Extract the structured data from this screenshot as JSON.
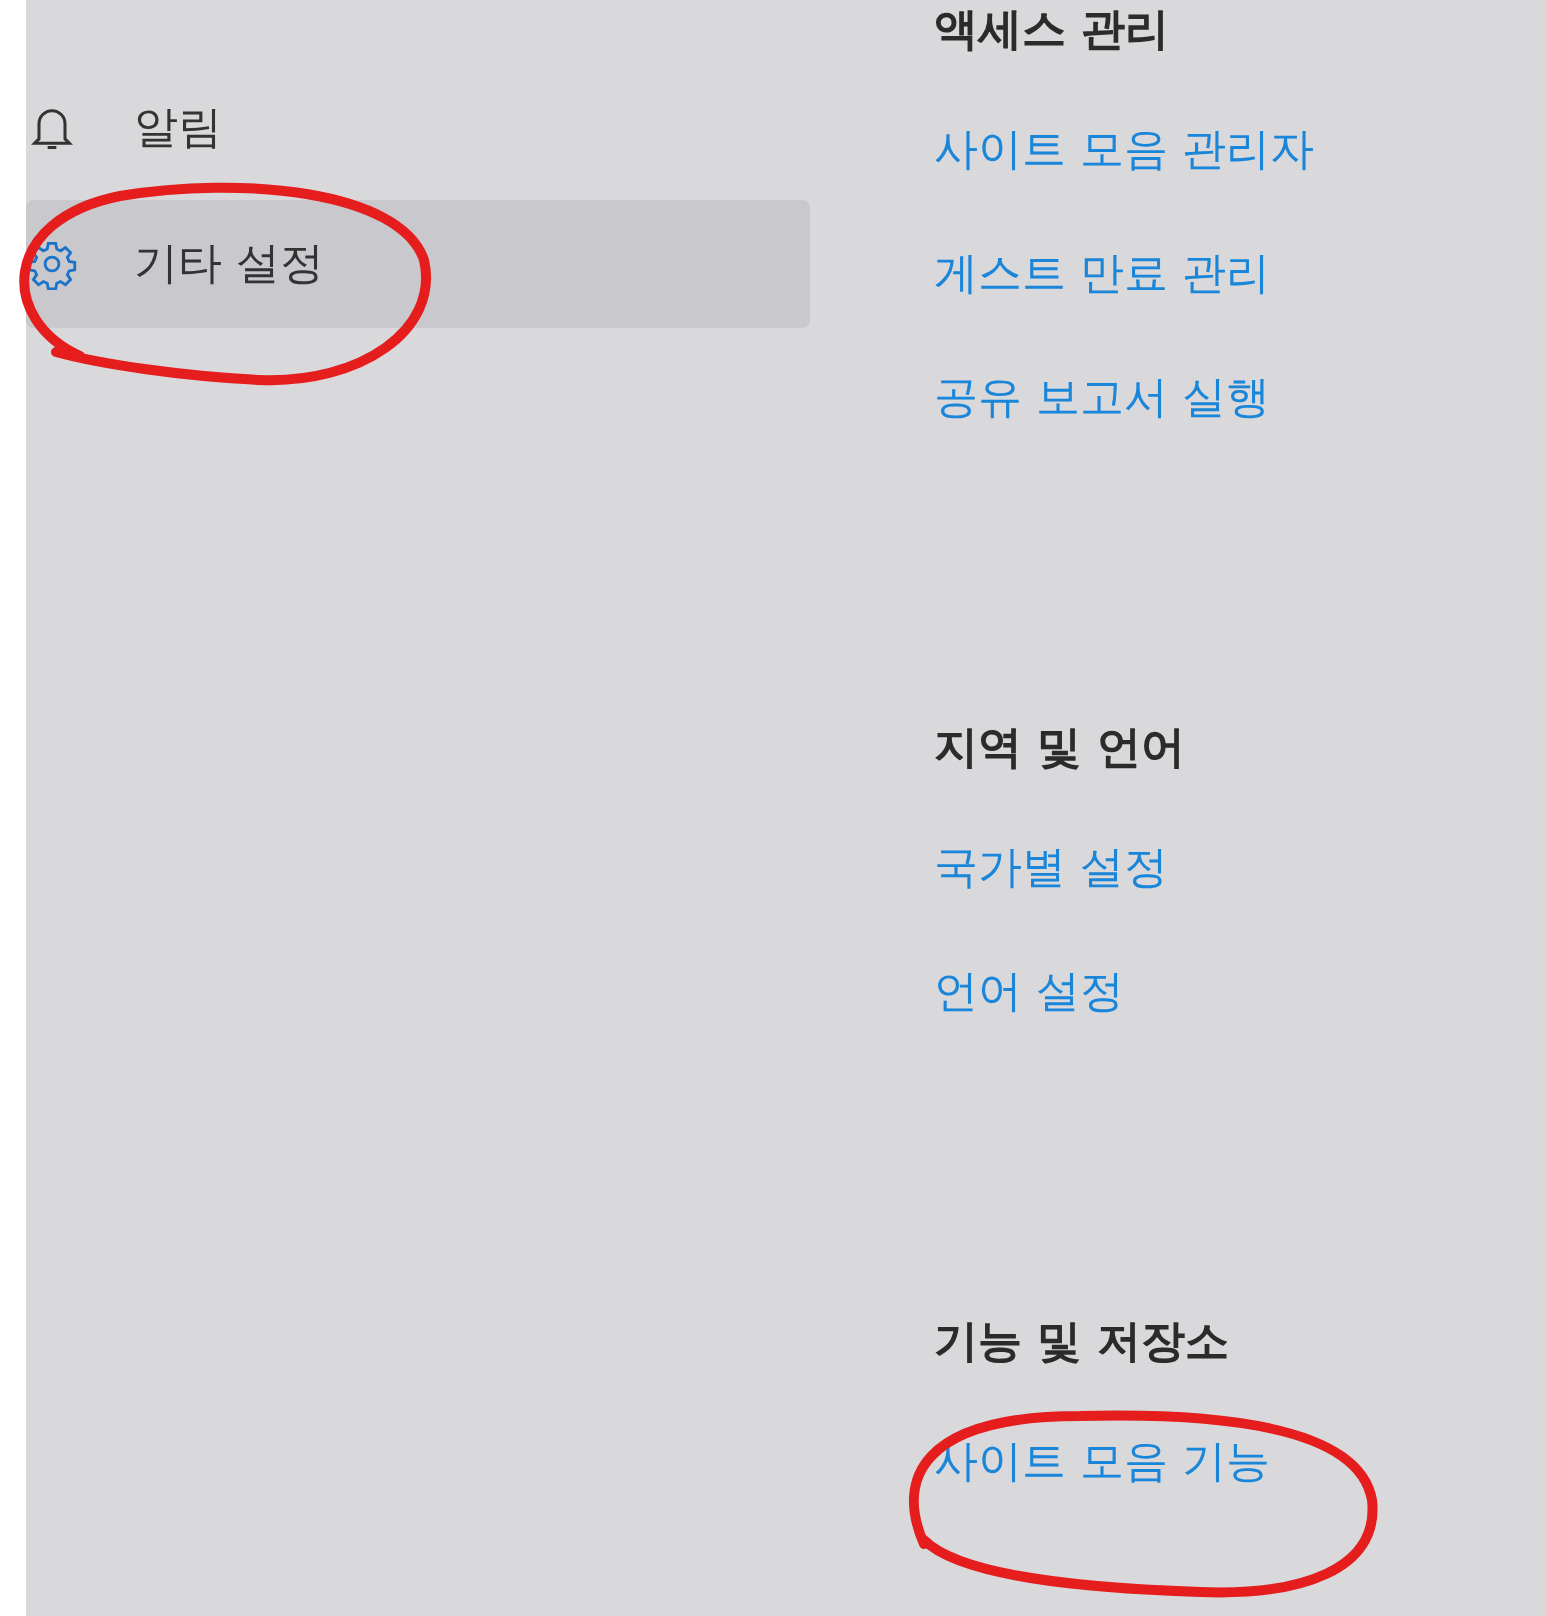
{
  "sidebar": {
    "items": [
      {
        "label": "알림",
        "selected": false
      },
      {
        "label": "기타 설정",
        "selected": true
      }
    ]
  },
  "sections": [
    {
      "heading": "액세스 관리",
      "links": [
        "사이트 모음 관리자",
        "게스트 만료 관리",
        "공유 보고서 실행"
      ]
    },
    {
      "heading": "지역 및 언어",
      "links": [
        "국가별 설정",
        "언어 설정"
      ]
    },
    {
      "heading": "기능 및 저장소",
      "links": [
        "사이트 모음 기능"
      ]
    }
  ]
}
